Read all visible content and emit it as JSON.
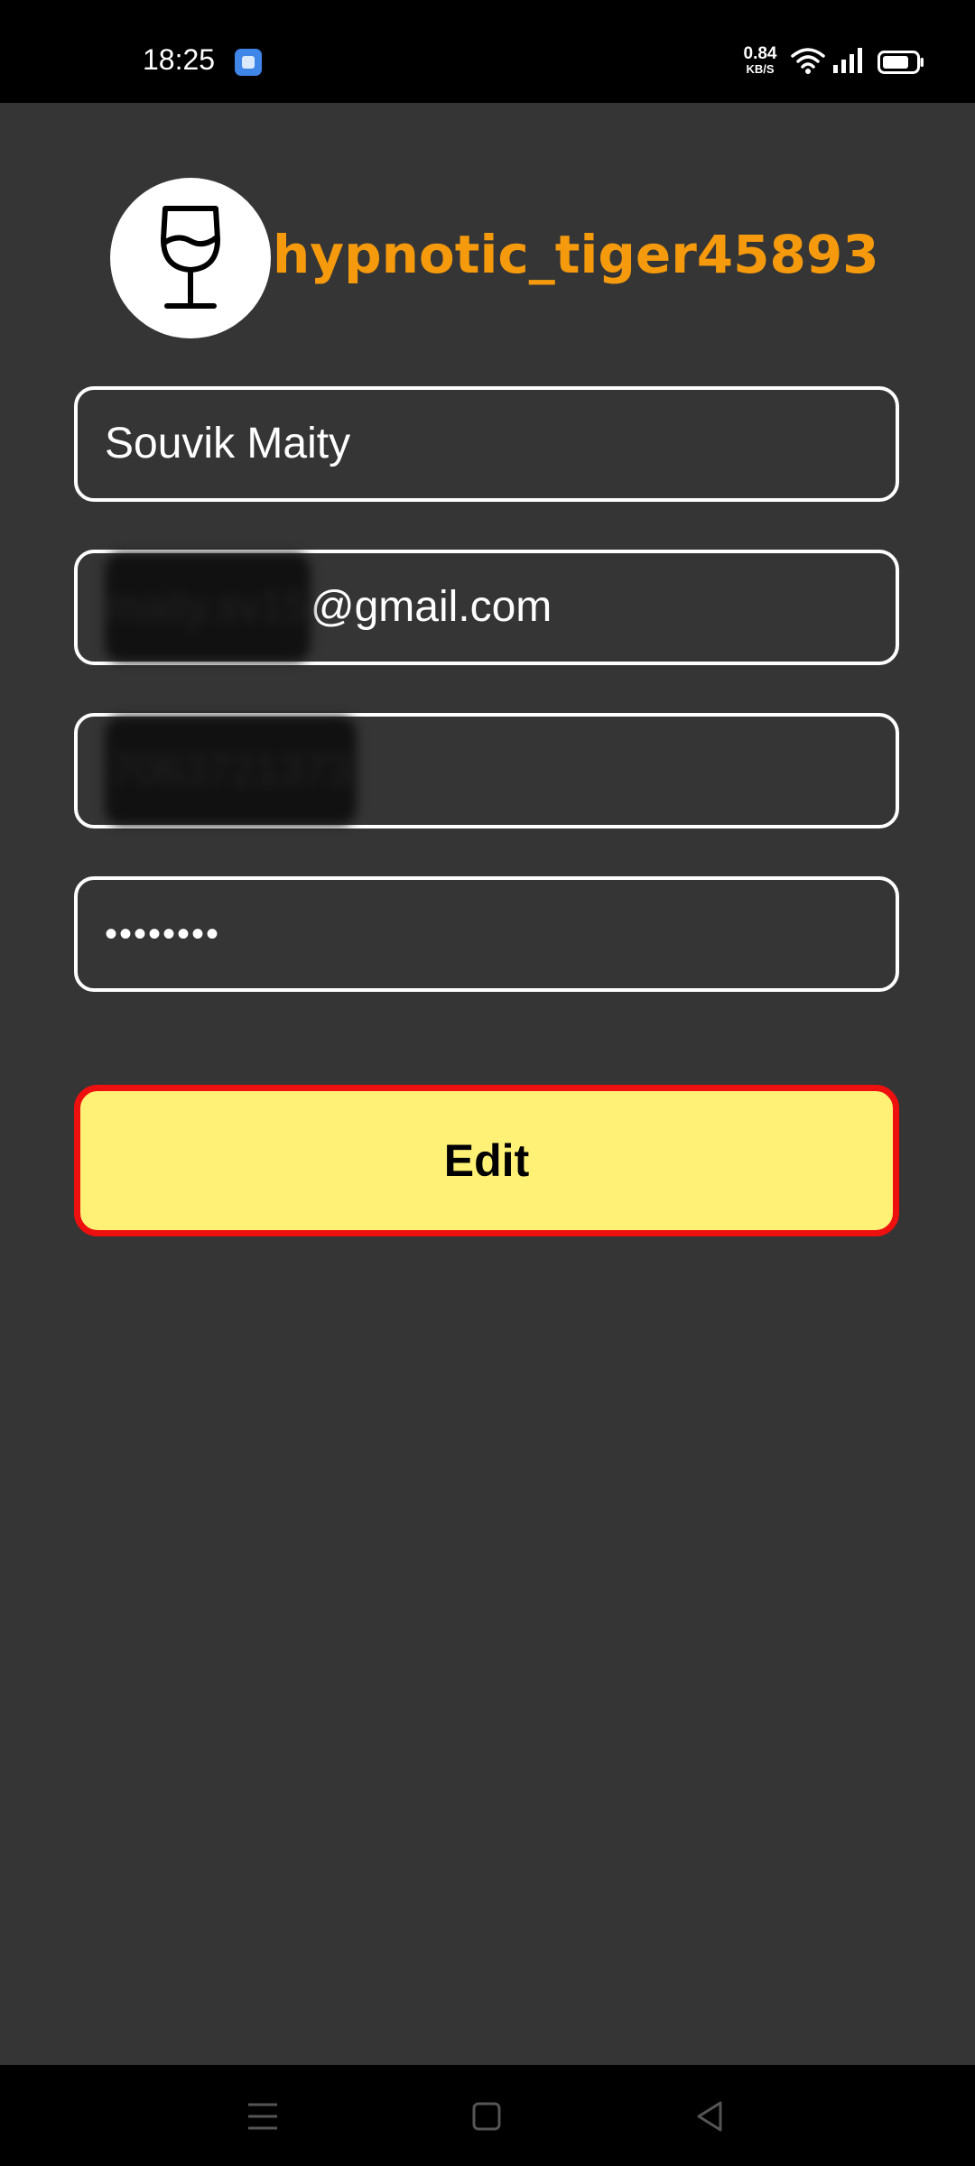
{
  "status_bar": {
    "time": "18:25",
    "network_speed_value": "0.84",
    "network_speed_unit": "KB/S",
    "icons": [
      "app-notification-icon",
      "wifi-icon",
      "cellular-signal-icon",
      "battery-icon"
    ]
  },
  "profile": {
    "avatar_icon": "wine-glass-icon",
    "username": "hypnotic_tiger45893",
    "username_color": "#f59a0c"
  },
  "form": {
    "name_value": "Souvik Maity",
    "email_local_redacted": "maity.sv15",
    "email_domain": "@gmail.com",
    "phone_redacted": "7063721373",
    "password_masked": "••••••••"
  },
  "actions": {
    "edit_label": "Edit",
    "edit_bg_color": "#fff176",
    "edit_border_color": "#ee0f0f"
  },
  "navigation": {
    "icons": [
      "menu-icon",
      "home-icon",
      "back-icon"
    ]
  },
  "theme": {
    "background": "#353535",
    "bar_background": "#000000"
  }
}
